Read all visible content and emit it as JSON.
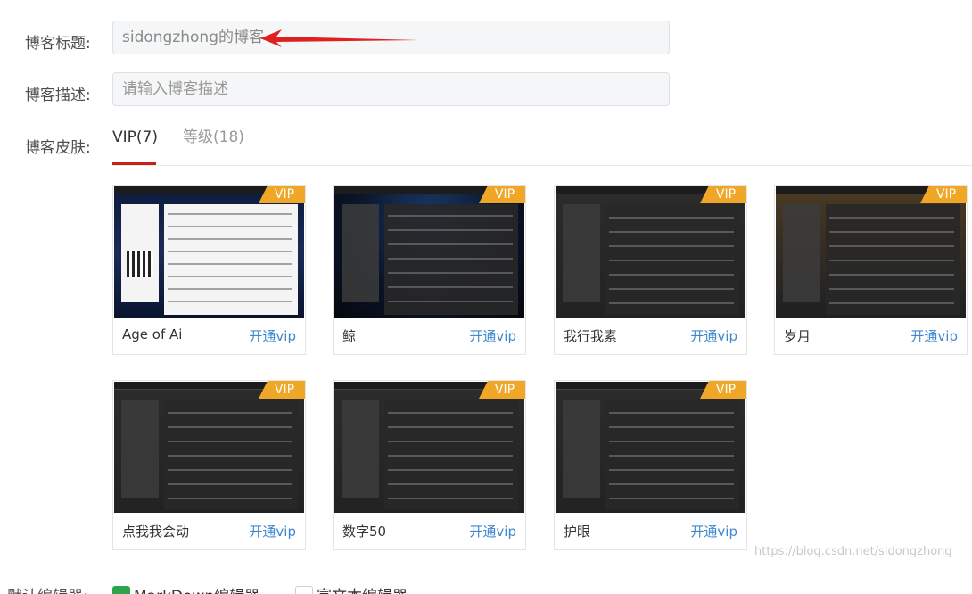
{
  "form": {
    "title_label": "博客标题:",
    "title_value": "sidongzhong的博客",
    "desc_label": "博客描述:",
    "desc_placeholder": "请输入博客描述",
    "skin_label": "博客皮肤:",
    "editor_label": "默认编辑器:"
  },
  "tabs": [
    {
      "label": "VIP(7)",
      "active": true
    },
    {
      "label": "等级(18)",
      "active": false
    }
  ],
  "skins": [
    {
      "name": "Age of Ai",
      "badge": "VIP",
      "action": "开通vip"
    },
    {
      "name": "鲸",
      "badge": "VIP",
      "action": "开通vip"
    },
    {
      "name": "我行我素",
      "badge": "VIP",
      "action": "开通vip"
    },
    {
      "name": "岁月",
      "badge": "VIP",
      "action": "开通vip"
    },
    {
      "name": "点我我会动",
      "badge": "VIP",
      "action": "开通vip"
    },
    {
      "name": "数字50",
      "badge": "VIP",
      "action": "开通vip"
    },
    {
      "name": "护眼",
      "badge": "VIP",
      "action": "开通vip"
    }
  ],
  "editors": [
    {
      "label": "MarkDown编辑器",
      "checked": true
    },
    {
      "label": "富文本编辑器",
      "checked": false
    }
  ],
  "watermark": "https://blog.csdn.net/sidongzhong",
  "colors": {
    "accent_red": "#c81e1e",
    "vip_orange": "#f0a626",
    "link_blue": "#3f88d0",
    "checkbox_green": "#2ea44f"
  }
}
